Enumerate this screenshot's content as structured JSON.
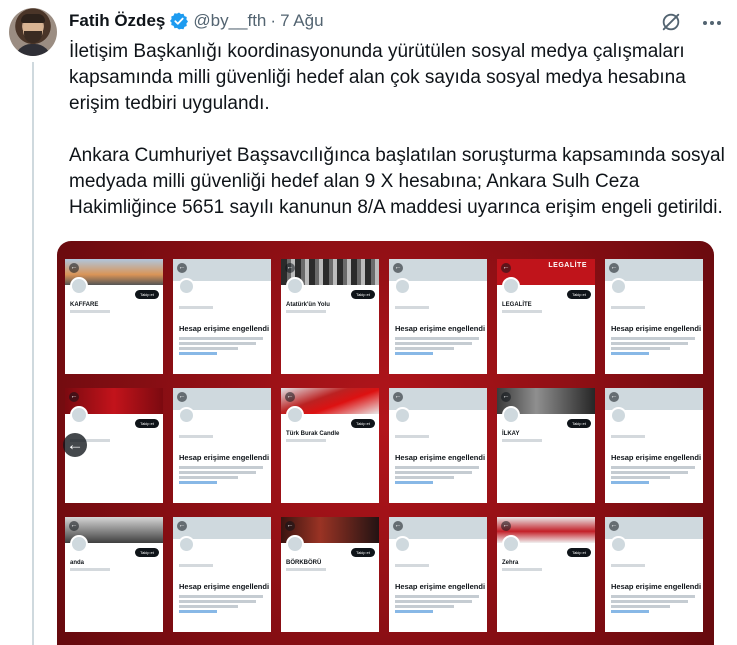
{
  "tweet": {
    "author_name": "Fatih Özdeş",
    "handle": "@by__fth",
    "separator": "·",
    "date": "7 Ağu",
    "paragraphs": [
      "İletişim Başkanlığı koordinasyonunda yürütülen sosyal medya çalışmaları kapsamında milli güvenliği hedef alan çok sayıda sosyal medya hesabına erişim tedbiri uygulandı.",
      "Ankara Cumhuriyet Başsavcılığınca başlatılan soruşturma kapsamında sosyal medyada milli güvenliği hedef alan 9 X hesabına; Ankara Sulh Ceza Hakimliğince 5651 sayılı kanunun 8/A maddesi uyarınca erişim engeli getirildi."
    ]
  },
  "icons": {
    "verified": "verified-badge-icon",
    "grok": "grok-icon",
    "more": "more-icon"
  },
  "colors": {
    "verified_blue": "#1d9bf0",
    "text_primary": "#0f1419",
    "text_secondary": "#536471",
    "media_background": "#9e1217"
  },
  "media": {
    "blocked_title": "Hesap erişime engellendi",
    "follow_label": "Takip et",
    "cards": [
      {
        "type": "profile",
        "banner": "b-sky",
        "name": "KAFFARE"
      },
      {
        "type": "blocked"
      },
      {
        "type": "profile",
        "banner": "b-mon",
        "name": "Atatürk'ün Yolu"
      },
      {
        "type": "blocked"
      },
      {
        "type": "profile",
        "banner": "b-leg",
        "name": "LEGALİTE",
        "banner_text": "LEGALİTE"
      },
      {
        "type": "blocked"
      },
      {
        "type": "profile",
        "banner": "b-red",
        "name": ""
      },
      {
        "type": "blocked"
      },
      {
        "type": "profile",
        "banner": "b-flag",
        "name": "Türk Burak Candle"
      },
      {
        "type": "blocked"
      },
      {
        "type": "profile",
        "banner": "b-ata",
        "name": "İLKAY"
      },
      {
        "type": "blocked"
      },
      {
        "type": "profile",
        "banner": "b-tank",
        "name": "anda"
      },
      {
        "type": "blocked"
      },
      {
        "type": "profile",
        "banner": "b-dark",
        "name": "BÖRKBÖRÜ"
      },
      {
        "type": "blocked"
      },
      {
        "type": "profile",
        "banner": "b-anit",
        "name": "Zehra"
      },
      {
        "type": "blocked"
      }
    ]
  }
}
